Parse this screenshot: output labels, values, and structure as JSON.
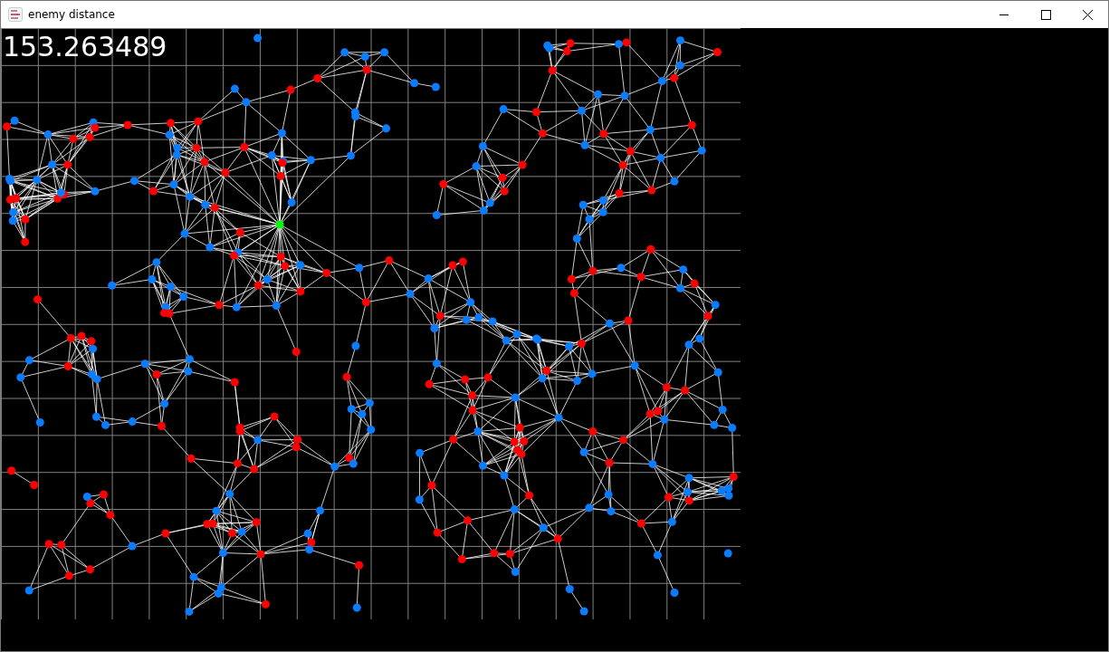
{
  "window": {
    "title": "enemy distance"
  },
  "readout": "153.263489"
}
